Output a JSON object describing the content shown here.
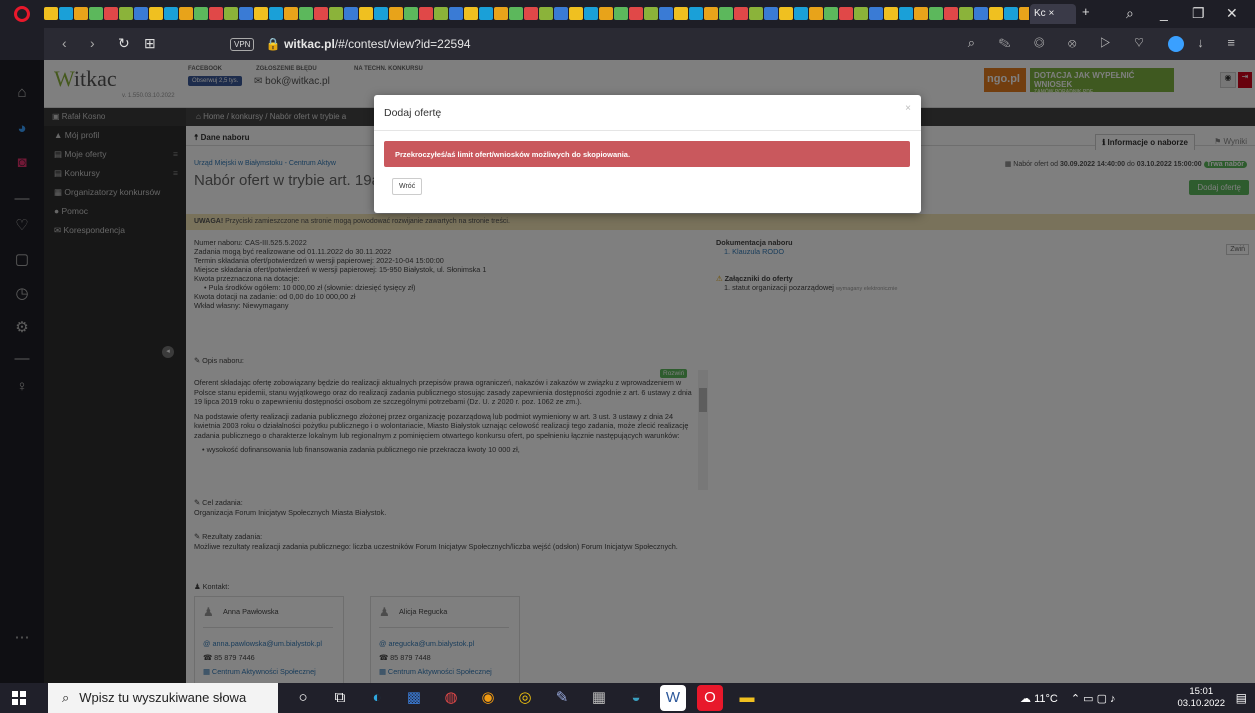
{
  "browser": {
    "active_tab_label": "Kc",
    "new_tab": "+",
    "url_prefix": "witkac.pl",
    "url_path": "/#/contest/view?id=22594",
    "vpn_label": "VPN",
    "tab_colors": [
      "#f0c020",
      "#1aa0d8",
      "#e8a31a",
      "#5cb85c",
      "#e04848",
      "#8bb33a",
      "#3a7bd5"
    ]
  },
  "site": {
    "logo_text": "itkac",
    "logo_w": "W",
    "version": "v. 1.550.03.10.2022",
    "facebook_label": "FACEBOOK",
    "facebook_button": "Obserwuj 2,5 tys.",
    "report_label": "ZGŁOSZENIE BŁĘDU",
    "report_mail": "bok@witkac.pl",
    "tech_label": "NA TECHN. KONKURSU",
    "ngo_logo": "ngo.pl",
    "ngo_banner_top": "DOTACJA  JAK WYPEŁNIĆ WNIOSEK",
    "ngo_banner_sub": "ZAMÓW PORADNIK PDF",
    "user_name": "Rafał Kosno",
    "breadcrumb": "Home / konkursy / Nabór ofert w trybie a"
  },
  "nav": [
    {
      "label": "Mój profil"
    },
    {
      "label": "Moje oferty"
    },
    {
      "label": "Konkursy"
    },
    {
      "label": "Organizatorzy konkursów"
    },
    {
      "label": "Pomoc"
    },
    {
      "label": "Korespondencja"
    }
  ],
  "contest": {
    "section_header": "Dane naboru",
    "tab_info": "Informacje o naborze",
    "tab_results": "Wyniki",
    "org_line": "Urząd Miejski w Białymstoku - Centrum Aktyw",
    "title": "Nabór ofert w trybie art. 19a",
    "date_line_prefix": "Nabór ofert od",
    "date_from": "30.09.2022 14:40:00",
    "date_to_word": "do",
    "date_to": "03.10.2022 15:00:00",
    "status": "Trwa nabór",
    "add_offer": "Dodaj ofertę",
    "warning_bold": "UWAGA!",
    "warning_text": "Przyciski zamieszczone na stronie mogą powodować rozwijanie zawartych na stronie treści.",
    "details": [
      "Numer naboru: CAS-III.525.5.2022",
      "Zadania mogą być realizowane od 01.11.2022 do 30.11.2022",
      "Termin składania ofert/potwierdzeń w wersji papierowej: 2022-10-04 15:00:00",
      "Miejsce składania ofert/potwierdzeń w wersji papierowej: 15-950 Białystok, ul. Słonimska 1",
      "Kwota przeznaczona na dotacje:",
      "• Pula środków ogółem: 10 000,00 zł (słownie: dziesięć tysięcy zł)",
      "Kwota dotacji na zadanie: od 0,00 do 10 000,00 zł",
      "Wkład własny: Niewymagany"
    ],
    "docs_header": "Dokumentacja naboru",
    "docs_item": "1. Klauzula RODO",
    "attach_header": "Załączniki do oferty",
    "attach_item": "1. statut organizacji pozarządowej",
    "attach_note": "wymagany elektronicznie",
    "collapse": "Zwiń",
    "desc_label": "Opis naboru:",
    "expand": "Rozwiń",
    "desc_p1": "Oferent składając ofertę zobowiązany będzie do realizacji aktualnych przepisów prawa ograniczeń, nakazów i zakazów w związku z wprowadzeniem w Polsce stanu epidemii, stanu wyjątkowego oraz do realizacji zadania publicznego stosując zasady zapewnienia dostępności zgodnie z art. 6 ustawy z dnia 19 lipca 2019 roku o zapewnieniu dostępności osobom ze szczególnymi potrzebami (Dz. U. z 2020 r. poz. 1062 ze zm.).",
    "desc_p2": "Na podstawie oferty realizacji zadania publicznego złożonej przez organizację pozarządową lub podmiot wymieniony w art. 3 ust. 3 ustawy z dnia 24 kwietnia 2003 roku o działalności pożytku publicznego i o wolontariacie, Miasto Białystok uznając celowość realizacji tego zadania, może zlecić realizację zadania publicznego o charakterze lokalnym lub regionalnym z pominięciem otwartego konkursu ofert, po spełnieniu łącznie następujących warunków:",
    "desc_p3": "• wysokość dofinansowania lub finansowania zadania publicznego nie przekracza kwoty 10 000 zł,",
    "goal_label": "Cel zadania:",
    "goal_text": "Organizacja Forum Inicjatyw Społecznych Miasta Białystok.",
    "results_label": "Rezultaty zadania:",
    "results_text": "Możliwe rezultaty realizacji zadania publicznego: liczba uczestników Forum Inicjatyw Społecznych/liczba wejść (odsłon) Forum Inicjatyw Społecznych.",
    "contact_label": "Kontakt:",
    "contacts": [
      {
        "name": "Anna Pawłowska",
        "email": "anna.pawlowska@um.bialystok.pl",
        "phone": "85 879 7446",
        "inst": "Centrum Aktywności Społecznej"
      },
      {
        "name": "Alicja Regucka",
        "email": "aregucka@um.bialystok.pl",
        "phone": "85 879 7448",
        "inst": "Centrum Aktywności Społecznej"
      }
    ]
  },
  "modal": {
    "title": "Dodaj ofertę",
    "close": "×",
    "alert": "Przekroczyłeś/aś limit ofert/wniosków możliwych do skopiowania.",
    "back": "Wróć"
  },
  "taskbar": {
    "search_placeholder": "Wpisz tu wyszukiwane słowa",
    "weather": "11°C",
    "time": "15:01",
    "date": "03.10.2022"
  }
}
